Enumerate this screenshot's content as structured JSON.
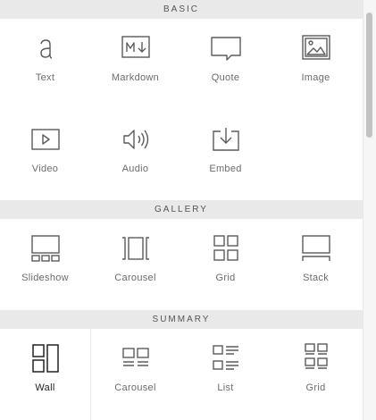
{
  "sections": [
    {
      "title": "BASIC",
      "items": [
        {
          "label": "Text",
          "icon": "text-icon"
        },
        {
          "label": "Markdown",
          "icon": "markdown-icon"
        },
        {
          "label": "Quote",
          "icon": "quote-icon"
        },
        {
          "label": "Image",
          "icon": "image-icon"
        },
        {
          "label": "Video",
          "icon": "video-icon"
        },
        {
          "label": "Audio",
          "icon": "audio-icon"
        },
        {
          "label": "Embed",
          "icon": "embed-icon"
        }
      ]
    },
    {
      "title": "GALLERY",
      "items": [
        {
          "label": "Slideshow",
          "icon": "slideshow-icon"
        },
        {
          "label": "Carousel",
          "icon": "carousel-icon"
        },
        {
          "label": "Grid",
          "icon": "grid-icon"
        },
        {
          "label": "Stack",
          "icon": "stack-icon"
        }
      ]
    },
    {
      "title": "SUMMARY",
      "items": [
        {
          "label": "Wall",
          "icon": "wall-icon",
          "selected": true
        },
        {
          "label": "Carousel",
          "icon": "summary-carousel-icon"
        },
        {
          "label": "List",
          "icon": "list-icon"
        },
        {
          "label": "Grid",
          "icon": "summary-grid-icon"
        }
      ]
    }
  ],
  "colors": {
    "header_bg": "#e9e9e9",
    "icon_stroke": "#5a5a5a",
    "selected_text": "#222222"
  }
}
